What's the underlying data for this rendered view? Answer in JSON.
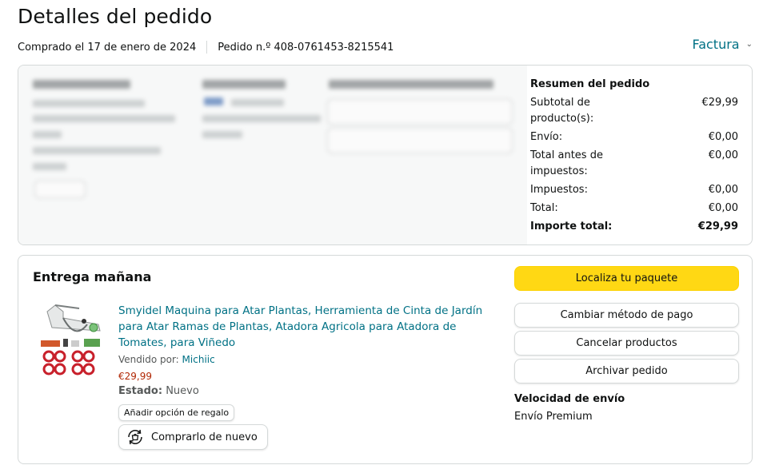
{
  "page": {
    "title": "Detalles del pedido",
    "purchase_date": "Comprado el 17 de enero de 2024",
    "order_number": "Pedido n.º 408-0761453-8215541",
    "invoice_label": "Factura"
  },
  "summary": {
    "heading": "Resumen del pedido",
    "rows": [
      {
        "label": "Subtotal de producto(s):",
        "value": "€29,99"
      },
      {
        "label": "Envío:",
        "value": "€0,00"
      },
      {
        "label": "Total antes de impuestos:",
        "value": "€0,00"
      },
      {
        "label": "Impuestos:",
        "value": "€0,00"
      },
      {
        "label": "Total:",
        "value": "€0,00"
      }
    ],
    "grand_total": {
      "label": "Importe total:",
      "value": "€29,99"
    }
  },
  "shipment": {
    "heading": "Entrega mañana",
    "product_title": "Smyidel Maquina para Atar Plantas, Herramienta de Cinta de Jardín para Atar Ramas de Plantas, Atadora Agricola para Atadora de Tomates, para Viñedo",
    "sold_by_label": "Vendido por:",
    "seller": "Michiic",
    "price": "€29,99",
    "status_label": "Estado:",
    "status_value": "Nuevo",
    "gift_button": "Añadir opción de regalo",
    "buy_again_button": "Comprarlo de nuevo"
  },
  "actions": {
    "track": "Localiza tu paquete",
    "change_payment": "Cambiar método de pago",
    "cancel": "Cancelar productos",
    "archive": "Archivar pedido"
  },
  "shipping_speed": {
    "heading": "Velocidad de envío",
    "value": "Envío Premium"
  },
  "colors": {
    "link": "#007185",
    "price": "#b12704",
    "primary_button": "#ffd814"
  }
}
